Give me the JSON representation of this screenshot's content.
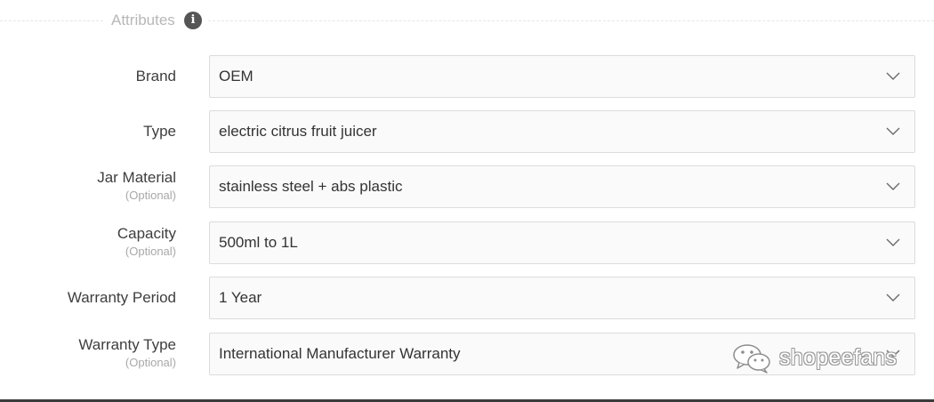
{
  "section": {
    "title": "Attributes",
    "info_icon": "i"
  },
  "attributes": [
    {
      "label": "Brand",
      "optional": "",
      "value": "OEM"
    },
    {
      "label": "Type",
      "optional": "",
      "value": "electric citrus fruit juicer"
    },
    {
      "label": "Jar Material",
      "optional": "(Optional)",
      "value": "stainless steel + abs plastic"
    },
    {
      "label": "Capacity",
      "optional": "(Optional)",
      "value": "500ml to 1L"
    },
    {
      "label": "Warranty Period",
      "optional": "",
      "value": "1 Year"
    },
    {
      "label": "Warranty Type",
      "optional": "(Optional)",
      "value": "International Manufacturer Warranty"
    }
  ],
  "watermark": {
    "text": "shopeefans",
    "icon": "wechat-icon"
  },
  "icons": {
    "dropdown": "chevron-down-icon",
    "info": "info-icon"
  },
  "colors": {
    "label_text": "#3e3e3e",
    "optional_text": "#a8a8a8",
    "field_border": "#dcdcdc",
    "field_background": "#fafafa",
    "section_title": "#b7b7b7"
  }
}
